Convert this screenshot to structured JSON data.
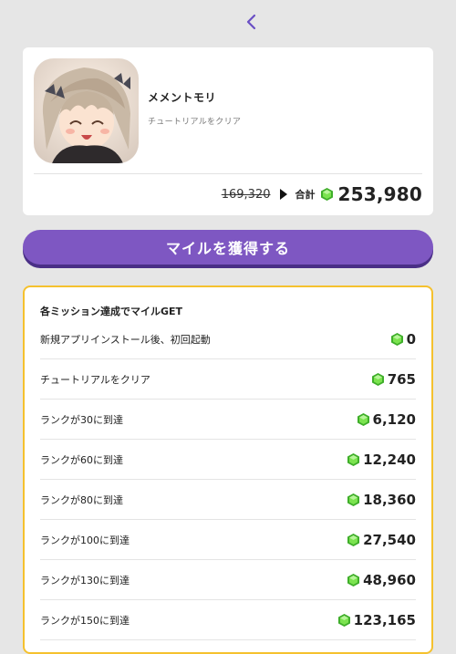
{
  "nav": {
    "back_icon": "chevron-left-icon"
  },
  "app": {
    "name": "メメントモリ",
    "subtitle": "チュートリアルをクリア",
    "icon": "app-icon-anime-girl"
  },
  "price": {
    "old_value": "169,320",
    "total_label": "合計",
    "total_value": "253,980",
    "gem_icon": "green-gem-icon"
  },
  "cta": {
    "label": "マイルを獲得する"
  },
  "missions": {
    "title": "各ミッション達成でマイルGET",
    "items": [
      {
        "label": "新規アプリインストール後、初回起動",
        "value": "0"
      },
      {
        "label": "チュートリアルをクリア",
        "value": "765"
      },
      {
        "label": "ランクが30に到達",
        "value": "6,120"
      },
      {
        "label": "ランクが60に到達",
        "value": "12,240"
      },
      {
        "label": "ランクが80に到達",
        "value": "18,360"
      },
      {
        "label": "ランクが100に到達",
        "value": "27,540"
      },
      {
        "label": "ランクが130に到達",
        "value": "48,960"
      },
      {
        "label": "ランクが150に到達",
        "value": "123,165"
      }
    ]
  },
  "colors": {
    "accent": "#7e57c2",
    "accent_shadow": "#4a2f86",
    "mission_border": "#f5c12e",
    "gem": "#5ccc3a",
    "background": "#e6e6e6"
  }
}
